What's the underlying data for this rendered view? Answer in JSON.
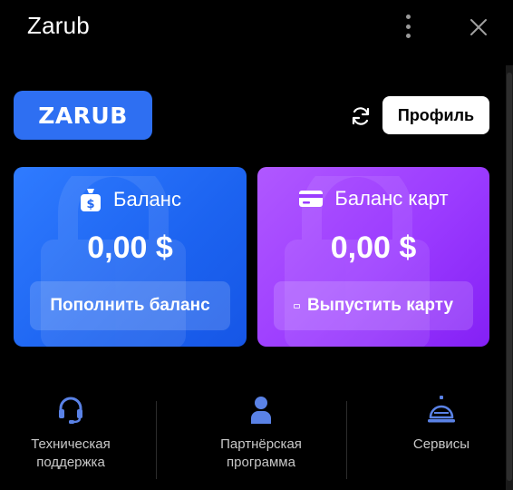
{
  "header": {
    "title": "Zarub",
    "menu_icon": "kebab-menu-icon",
    "close_icon": "close-icon"
  },
  "toolbar": {
    "brand_label": "ZARUB",
    "refresh_icon": "refresh-icon",
    "profile_label": "Профиль"
  },
  "cards": [
    {
      "icon": "money-bag-icon",
      "title": "Баланс",
      "amount": "0,00 $",
      "button_label": "Пополнить баланс",
      "color": "#1f66f2"
    },
    {
      "icon": "credit-card-icon",
      "title": "Баланс карт",
      "amount": "0,00 $",
      "button_label": "Выпустить карту",
      "color": "#9a3cff"
    }
  ],
  "bottom_nav": [
    {
      "icon": "headset-icon",
      "line1": "Техническая",
      "line2": "поддержка"
    },
    {
      "icon": "user-icon",
      "line1": "Партнёрская",
      "line2": "программа"
    },
    {
      "icon": "service-bell-icon",
      "line1": "Сервисы",
      "line2": ""
    }
  ],
  "colors": {
    "background": "#000000",
    "brand_blue": "#2e6ff2",
    "icon_blue": "#5a82e6",
    "text_muted": "#c8c8c8"
  }
}
